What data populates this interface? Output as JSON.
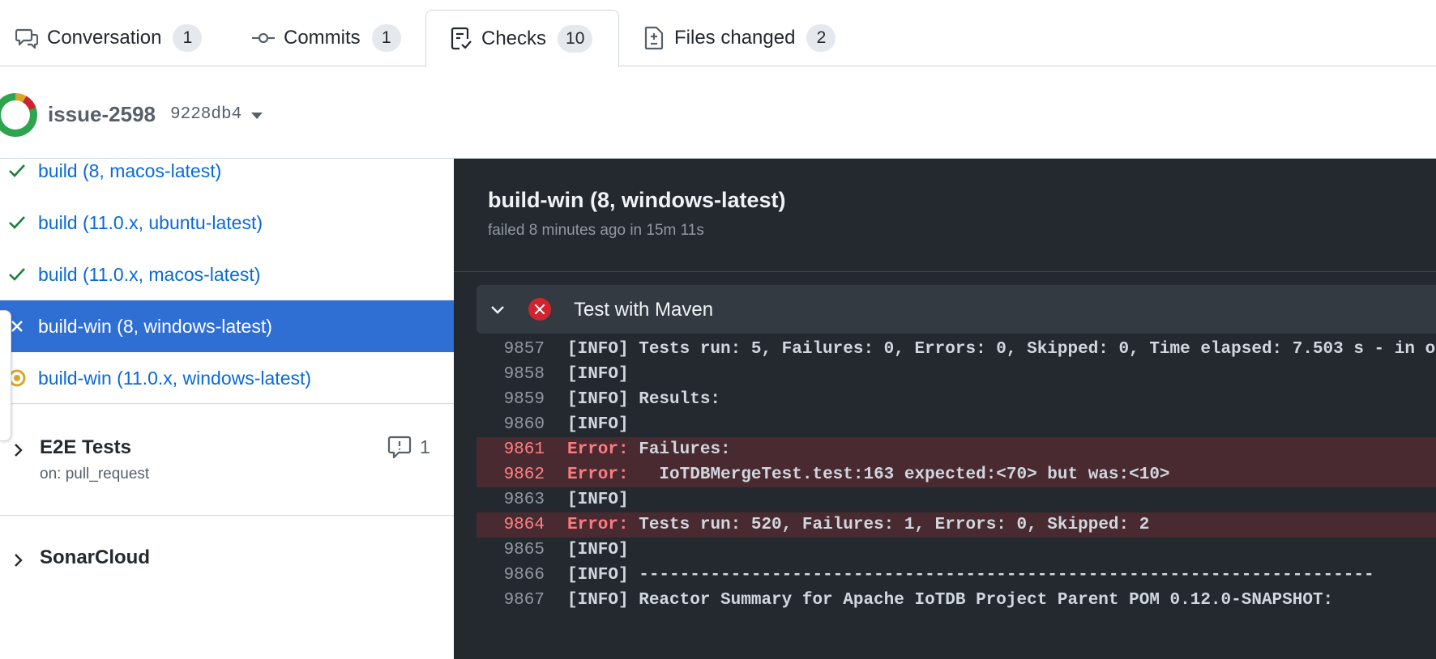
{
  "tabs": [
    {
      "label": "Conversation",
      "count": "1",
      "icon": "comment-discussion-icon"
    },
    {
      "label": "Commits",
      "count": "1",
      "icon": "git-commit-icon"
    },
    {
      "label": "Checks",
      "count": "10",
      "icon": "checklist-icon",
      "selected": true
    },
    {
      "label": "Files changed",
      "count": "2",
      "icon": "file-diff-icon"
    }
  ],
  "branch": {
    "name": "issue-2598",
    "sha": "9228db4"
  },
  "sidebar": {
    "jobs": [
      {
        "label": "build (8, macos-latest)",
        "status": "success"
      },
      {
        "label": "build (11.0.x, ubuntu-latest)",
        "status": "success"
      },
      {
        "label": "build (11.0.x, macos-latest)",
        "status": "success"
      },
      {
        "label": "build-win (8, windows-latest)",
        "status": "failure",
        "selected": true
      },
      {
        "label": "build-win (11.0.x, windows-latest)",
        "status": "in-progress"
      }
    ],
    "workflows": [
      {
        "title": "E2E Tests",
        "subtitle": "on: pull_request",
        "comment_count": "1"
      },
      {
        "title": "SonarCloud"
      }
    ]
  },
  "log": {
    "job_title": "build-win (8, windows-latest)",
    "job_status": "failed 8 minutes ago in 15m 11s",
    "step_title": "Test with Maven",
    "error_label": "Error:",
    "lines": [
      {
        "num": "9857",
        "text": "[INFO] Tests run: 5, Failures: 0, Errors: 0, Skipped: 0, Time elapsed: 7.503 s - in o",
        "error": false
      },
      {
        "num": "9858",
        "text": "[INFO]",
        "error": false
      },
      {
        "num": "9859",
        "text": "[INFO] Results:",
        "error": false
      },
      {
        "num": "9860",
        "text": "[INFO]",
        "error": false
      },
      {
        "num": "9861",
        "text": " Failures:",
        "error": true
      },
      {
        "num": "9862",
        "text": "   IoTDBMergeTest.test:163 expected:<70> but was:<10>",
        "error": true
      },
      {
        "num": "9863",
        "text": "[INFO]",
        "error": false
      },
      {
        "num": "9864",
        "text": " Tests run: 520, Failures: 1, Errors: 0, Skipped: 2",
        "error": true
      },
      {
        "num": "9865",
        "text": "[INFO]",
        "error": false
      },
      {
        "num": "9866",
        "text": "[INFO] ------------------------------------------------------------------------",
        "error": false
      },
      {
        "num": "9867",
        "text": "[INFO] Reactor Summary for Apache IoTDB Project Parent POM 0.12.0-SNAPSHOT:",
        "error": false
      }
    ]
  },
  "colors": {
    "link": "#0969da",
    "selected_bg": "#2f6fd4",
    "success": "#1a7f37",
    "failure": "#d1242f",
    "in_progress": "#d4a72c",
    "log_bg": "#24292f",
    "error_row_bg": "#4a2a31"
  }
}
